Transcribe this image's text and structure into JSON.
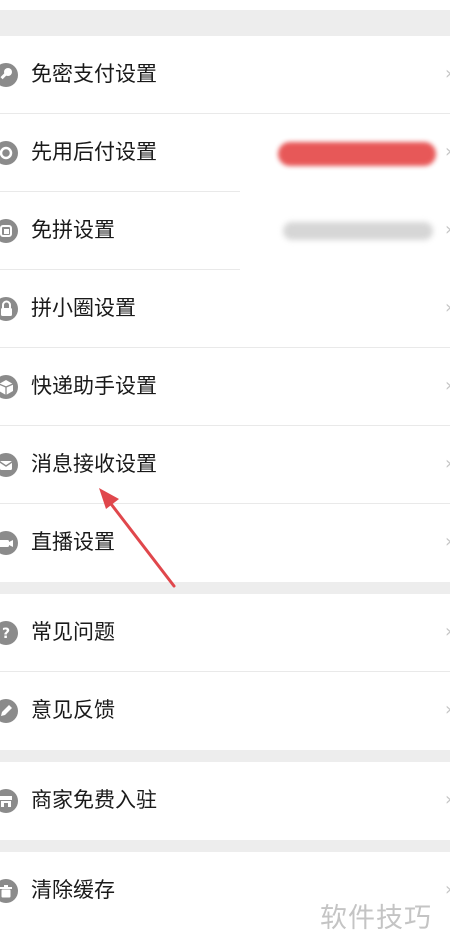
{
  "groups": [
    {
      "items": [
        {
          "label": "免密支付设置",
          "icon": "key-icon"
        },
        {
          "label": "先用后付设置",
          "icon": "badge-icon"
        },
        {
          "label": "免拼设置",
          "icon": "group-card-icon"
        },
        {
          "label": "拼小圈设置",
          "icon": "lock-icon"
        },
        {
          "label": "快递助手设置",
          "icon": "package-icon"
        },
        {
          "label": "消息接收设置",
          "icon": "envelope-icon"
        },
        {
          "label": "直播设置",
          "icon": "video-camera-icon"
        }
      ]
    },
    {
      "items": [
        {
          "label": "常见问题",
          "icon": "question-icon"
        },
        {
          "label": "意见反馈",
          "icon": "pencil-icon"
        }
      ]
    },
    {
      "items": [
        {
          "label": "商家免费入驻",
          "icon": "store-icon"
        }
      ]
    },
    {
      "items": [
        {
          "label": "清除缓存",
          "icon": "trash-icon"
        }
      ]
    }
  ],
  "colors": {
    "annotation_arrow": "#e0474c",
    "icon_gray": "#8b8b8b",
    "page_background": "#ededed"
  },
  "watermark": "软件技巧"
}
